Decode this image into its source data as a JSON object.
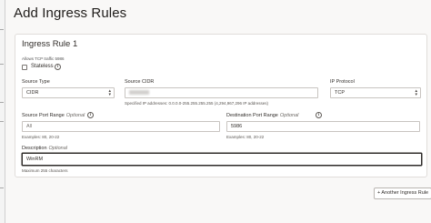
{
  "dialog": {
    "title": "Add Ingress Rules"
  },
  "rule": {
    "heading": "Ingress Rule 1",
    "allows_text": "Allows TCP traffic 5986",
    "stateless_label": "Stateless",
    "source_type": {
      "label": "Source Type",
      "value": "CIDR"
    },
    "source_cidr": {
      "label": "Source CIDR",
      "value": "",
      "hint": "Specified IP addresses: 0.0.0.0-255.255.255.255 (4,294,967,296 IP addresses)"
    },
    "ip_protocol": {
      "label": "IP Protocol",
      "value": "TCP"
    },
    "source_port": {
      "label": "Source Port Range",
      "optional": "Optional",
      "placeholder": "All",
      "hint": "Examples: 80, 20-22"
    },
    "dest_port": {
      "label": "Destination Port Range",
      "optional": "Optional",
      "value": "5986",
      "hint": "Examples: 80, 20-22"
    },
    "description": {
      "label": "Description",
      "optional": "Optional",
      "value": "WinRM",
      "hint": "Maximum 255 characters"
    }
  },
  "actions": {
    "add_rule_label": "+ Another Ingress Rule"
  },
  "icons": {
    "info": "info-icon",
    "dropdown": "chevron-updown-icon"
  }
}
